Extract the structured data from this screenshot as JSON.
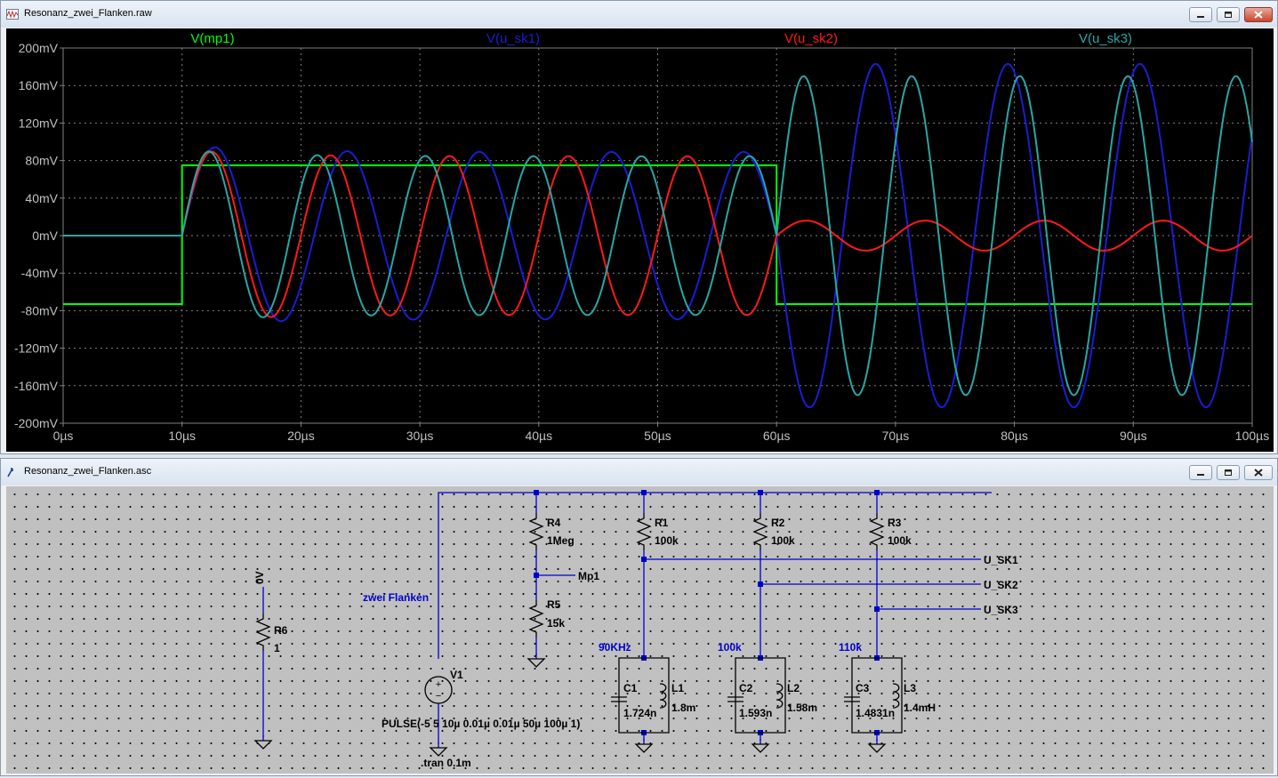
{
  "waveform_window": {
    "title": "Resonanz_zwei_Flanken.raw",
    "buttons": {
      "minimize": "minimize-icon",
      "maximize": "maximize-icon",
      "close": "close-icon"
    }
  },
  "schematic_window": {
    "title": "Resonanz_zwei_Flanken.asc",
    "buttons": {
      "minimize": "minimize-icon",
      "maximize": "maximize-icon",
      "close": "close-icon"
    }
  },
  "colors": {
    "plot_background": "#000000",
    "grid": "#808080",
    "axis_text": "#c0c0c0",
    "mp1": "#00ff00",
    "u_sk1": "#1c1cd4",
    "u_sk2": "#ff1a1a",
    "u_sk3": "#2aa6a6",
    "schematic_wire": "#0000cc",
    "schematic_label": "#0000cc"
  },
  "chart_data": {
    "type": "line",
    "title": "",
    "xlabel": "",
    "ylabel": "",
    "xlim": [
      0,
      100
    ],
    "ylim": [
      -200,
      200
    ],
    "x_unit": "µs",
    "y_unit": "mV",
    "grid": true,
    "x_ticks": [
      "0µs",
      "10µs",
      "20µs",
      "30µs",
      "40µs",
      "50µs",
      "60µs",
      "70µs",
      "80µs",
      "90µs",
      "100µs"
    ],
    "y_ticks": [
      "200mV",
      "160mV",
      "120mV",
      "80mV",
      "40mV",
      "0mV",
      "-40mV",
      "-80mV",
      "-120mV",
      "-160mV",
      "-200mV"
    ],
    "legend": [
      "V(mp1)",
      "V(u_sk1)",
      "V(u_sk2)",
      "V(u_sk3)"
    ],
    "series": [
      {
        "name": "V(mp1)",
        "color": "#00ff00",
        "kind": "pulse",
        "low": -73,
        "high": 75,
        "rise": 10,
        "fall": 60
      },
      {
        "name": "V(u_sk1)",
        "color": "#1c1cd4",
        "kind": "resonance",
        "freq_khz": 90,
        "amp1": 97,
        "amp2": 183,
        "phase2": 3.14159
      },
      {
        "name": "V(u_sk2)",
        "color": "#ff1a1a",
        "kind": "resonance",
        "freq_khz": 100,
        "amp1": 92,
        "amp2": 16,
        "phase2": 0.0
      },
      {
        "name": "V(u_sk3)",
        "color": "#2aa6a6",
        "kind": "resonance",
        "freq_khz": 110,
        "amp1": 92,
        "amp2": 170,
        "phase2": 0.0
      }
    ]
  },
  "schematic": {
    "ground_label": "0V",
    "r6": {
      "name": "R6",
      "value": "1"
    },
    "source_label": "zwei Flanken",
    "v1": {
      "name": "V1",
      "value": "PULSE(-5 5 10µ 0.01µ 0.01µ 50µ 100µ 1)"
    },
    "tran": ".tran 0.1m",
    "r4": {
      "name": "R4",
      "value": "1Meg"
    },
    "r5": {
      "name": "R5",
      "value": "15k"
    },
    "mp1": "Mp1",
    "r1": {
      "name": "R1",
      "value": "100k"
    },
    "r2": {
      "name": "R2",
      "value": "100k"
    },
    "r3": {
      "name": "R3",
      "value": "100k"
    },
    "net1": "U_SK1",
    "net2": "U_SK2",
    "net3": "U_SK3",
    "f1": "90KHz",
    "f2": "100k",
    "f3": "110k",
    "c1": {
      "name": "C1",
      "value": "1.724n"
    },
    "l1": {
      "name": "L1",
      "value": "1.8m"
    },
    "c2": {
      "name": "C2",
      "value": "1.593n"
    },
    "l2": {
      "name": "L2",
      "value": "1.58m"
    },
    "c3": {
      "name": "C3",
      "value": "1.4831n"
    },
    "l3": {
      "name": "L3",
      "value": "1.4mH"
    }
  }
}
